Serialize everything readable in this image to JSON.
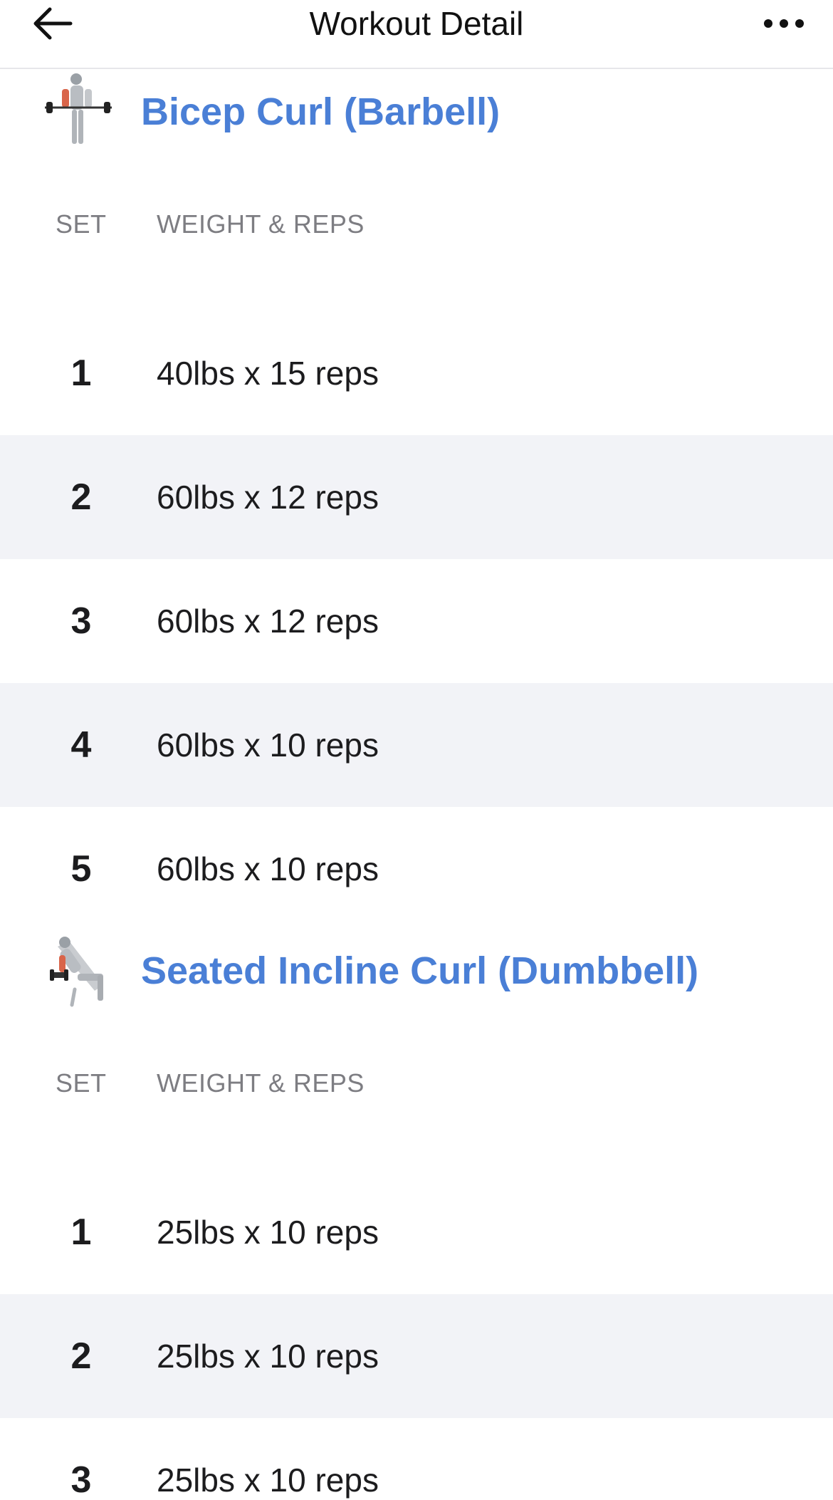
{
  "header": {
    "title": "Workout Detail",
    "back_icon": "arrow-left-icon",
    "more_icon": "more-horizontal-icon"
  },
  "colors": {
    "accent": "#4a7fd6",
    "row_shade": "#f2f3f7",
    "muted_text": "#7d7d82"
  },
  "exercises": [
    {
      "name": "Bicep Curl (Barbell)",
      "thumbnail_icon": "barbell-curl-figure-icon",
      "columns": {
        "set": "SET",
        "weight_reps": "WEIGHT & REPS"
      },
      "sets": [
        {
          "number": "1",
          "value": "40lbs x 15 reps"
        },
        {
          "number": "2",
          "value": "60lbs x 12 reps"
        },
        {
          "number": "3",
          "value": "60lbs x 12 reps"
        },
        {
          "number": "4",
          "value": "60lbs x 10 reps"
        },
        {
          "number": "5",
          "value": "60lbs x 10 reps"
        }
      ]
    },
    {
      "name": "Seated Incline Curl (Dumbbell)",
      "thumbnail_icon": "incline-curl-figure-icon",
      "columns": {
        "set": "SET",
        "weight_reps": "WEIGHT & REPS"
      },
      "sets": [
        {
          "number": "1",
          "value": "25lbs x 10 reps"
        },
        {
          "number": "2",
          "value": "25lbs x 10 reps"
        },
        {
          "number": "3",
          "value": "25lbs x 10 reps"
        }
      ]
    }
  ]
}
